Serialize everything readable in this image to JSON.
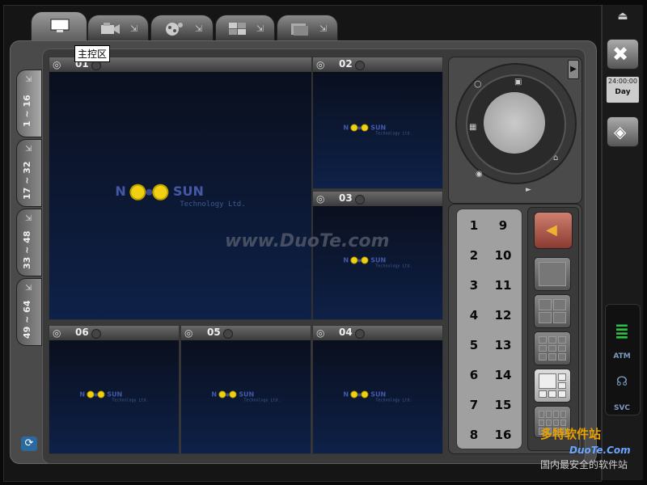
{
  "top_tabs": [
    {
      "icon": "monitor-icon",
      "active": true
    },
    {
      "icon": "video-camera-icon",
      "active": false
    },
    {
      "icon": "globe-network-icon",
      "active": false
    },
    {
      "icon": "config-grid-icon",
      "active": false
    },
    {
      "icon": "folder-icon",
      "active": false
    }
  ],
  "tooltip": "主控区",
  "side_tabs": [
    "1 ~ 16",
    "17 ~ 32",
    "33 ~ 48",
    "49 ~ 64"
  ],
  "cells": [
    {
      "num": "01"
    },
    {
      "num": "02"
    },
    {
      "num": "03"
    },
    {
      "num": "06"
    },
    {
      "num": "05"
    },
    {
      "num": "04"
    }
  ],
  "video_logo": {
    "brand_left": "N",
    "brand_right": "SUN",
    "subtitle": "Technology Ltd."
  },
  "watermark": "www.DuoTe.com",
  "numpad": [
    [
      "1",
      "9"
    ],
    [
      "2",
      "10"
    ],
    [
      "3",
      "11"
    ],
    [
      "4",
      "12"
    ],
    [
      "5",
      "13"
    ],
    [
      "6",
      "14"
    ],
    [
      "7",
      "15"
    ],
    [
      "8",
      "16"
    ]
  ],
  "clock": {
    "time": "24:00:00",
    "mode": "Day"
  },
  "indicators": [
    "ATM",
    "SVC"
  ],
  "branding": {
    "line1": "多特软件站",
    "line2": "DuoTe.Com",
    "line3": "国内最安全的软件站"
  },
  "colors": {
    "accent": "#4458a8",
    "video_bg": "#0e2148",
    "status_green": "#2ec04a"
  }
}
